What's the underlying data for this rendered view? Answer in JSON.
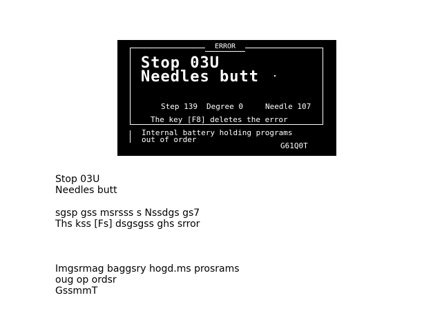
{
  "lcd": {
    "frame_title": "ERROR",
    "error_line1": "Stop 03U",
    "error_line2": "Needles butt",
    "step": "Step 139",
    "degree": "Degree 0",
    "needle": "Needle 107",
    "hint": "The key [F8] deletes the error",
    "battery_line1": "Internal battery holding programs",
    "battery_line2": "out of order",
    "code": "G61Q0T"
  },
  "ocr_text": {
    "line1": "Stop 03U",
    "line2": "Needles butt",
    "line3": "sgsp gss msrsss s Nssdgs gs7",
    "line4": "Ths kss [Fs] dsgsgss ghs srror",
    "line5": "Imgsrmag baggsry hogd.ms prosrams",
    "line6": "oug op ordsr",
    "line7": "GssmmT"
  }
}
